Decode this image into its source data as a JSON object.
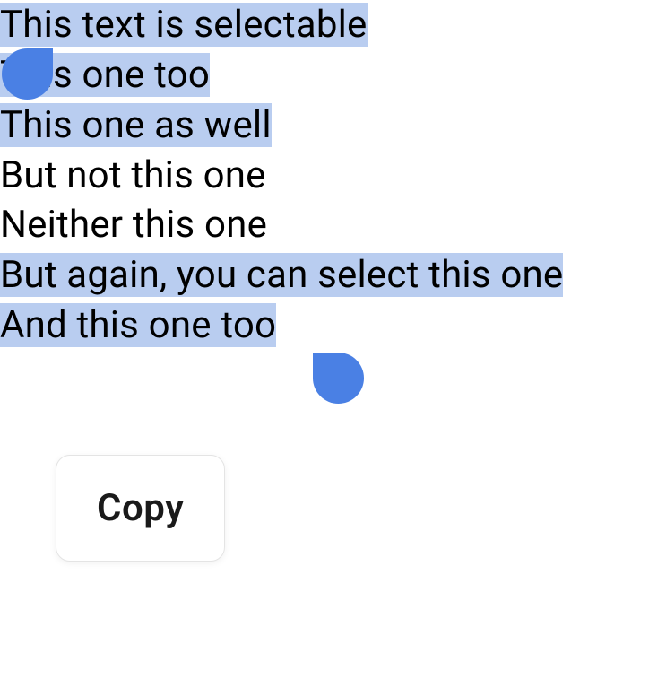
{
  "lines": [
    {
      "text": "This text is selectable"
    },
    {
      "text": "This one too"
    },
    {
      "text": "This one as well"
    },
    {
      "text": "But not this one"
    },
    {
      "text": "Neither this one"
    },
    {
      "text": "But again, you can select this one"
    },
    {
      "text": "And this one too"
    }
  ],
  "menu": {
    "copy_label": "Copy"
  },
  "colors": {
    "selection_highlight": "#b9cdf0",
    "handle": "#4a80e4"
  }
}
